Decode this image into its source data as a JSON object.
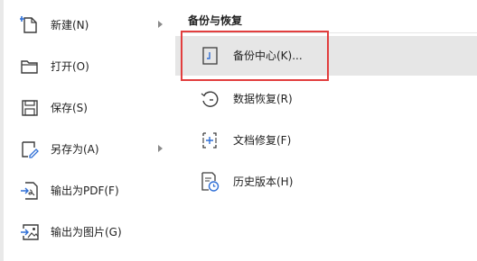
{
  "file_menu": {
    "items": [
      {
        "label": "新建(N)",
        "icon": "new-file-icon",
        "has_submenu": true
      },
      {
        "label": "打开(O)",
        "icon": "folder-open-icon",
        "has_submenu": false
      },
      {
        "label": "保存(S)",
        "icon": "save-icon",
        "has_submenu": false
      },
      {
        "label": "另存为(A)",
        "icon": "save-as-icon",
        "has_submenu": true
      },
      {
        "label": "输出为PDF(F)",
        "icon": "export-pdf-icon",
        "has_submenu": false
      },
      {
        "label": "输出为图片(G)",
        "icon": "export-image-icon",
        "has_submenu": false
      }
    ]
  },
  "submenu": {
    "title": "备份与恢复",
    "items": [
      {
        "label": "备份中心(K)...",
        "icon": "backup-center-icon",
        "active": true
      },
      {
        "label": "数据恢复(R)",
        "icon": "data-restore-icon",
        "active": false
      },
      {
        "label": "文档修复(F)",
        "icon": "document-repair-icon",
        "active": false
      },
      {
        "label": "历史版本(H)",
        "icon": "history-version-icon",
        "active": false
      }
    ]
  },
  "colors": {
    "highlight_border": "#e23e3e",
    "active_background": "#e6e6e6",
    "accent_blue": "#2f6fd6"
  }
}
